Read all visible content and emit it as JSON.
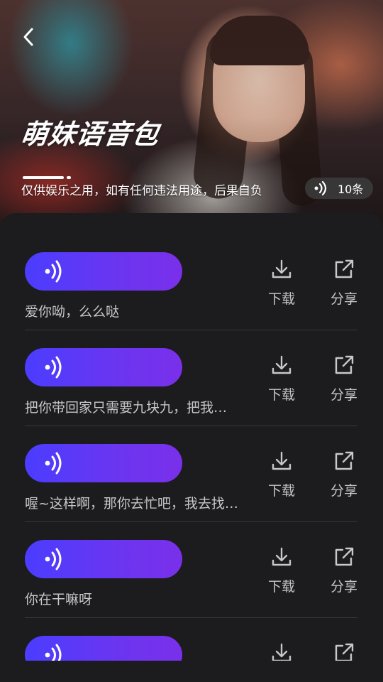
{
  "header": {
    "title": "萌妹语音包",
    "disclaimer": "仅供娱乐之用，如有任何违法用途，后果自负",
    "count_label": "10条"
  },
  "icons": {
    "back": "chevron-left-icon",
    "sound": "sound-wave-icon",
    "download": "download-icon",
    "share": "share-external-icon"
  },
  "colors": {
    "accent_start": "#4b3dff",
    "accent_end": "#7a30ea",
    "sheet_bg": "#1c1c1e",
    "secondary_text": "#c7c7cc"
  },
  "actions": {
    "download_label": "下载",
    "share_label": "分享"
  },
  "items": [
    {
      "text": "爱你呦，么么哒"
    },
    {
      "text": "把你带回家只需要九块九，把我…"
    },
    {
      "text": "喔~这样啊，那你去忙吧，我去找…"
    },
    {
      "text": "你在干嘛呀"
    },
    {
      "text": ""
    }
  ]
}
